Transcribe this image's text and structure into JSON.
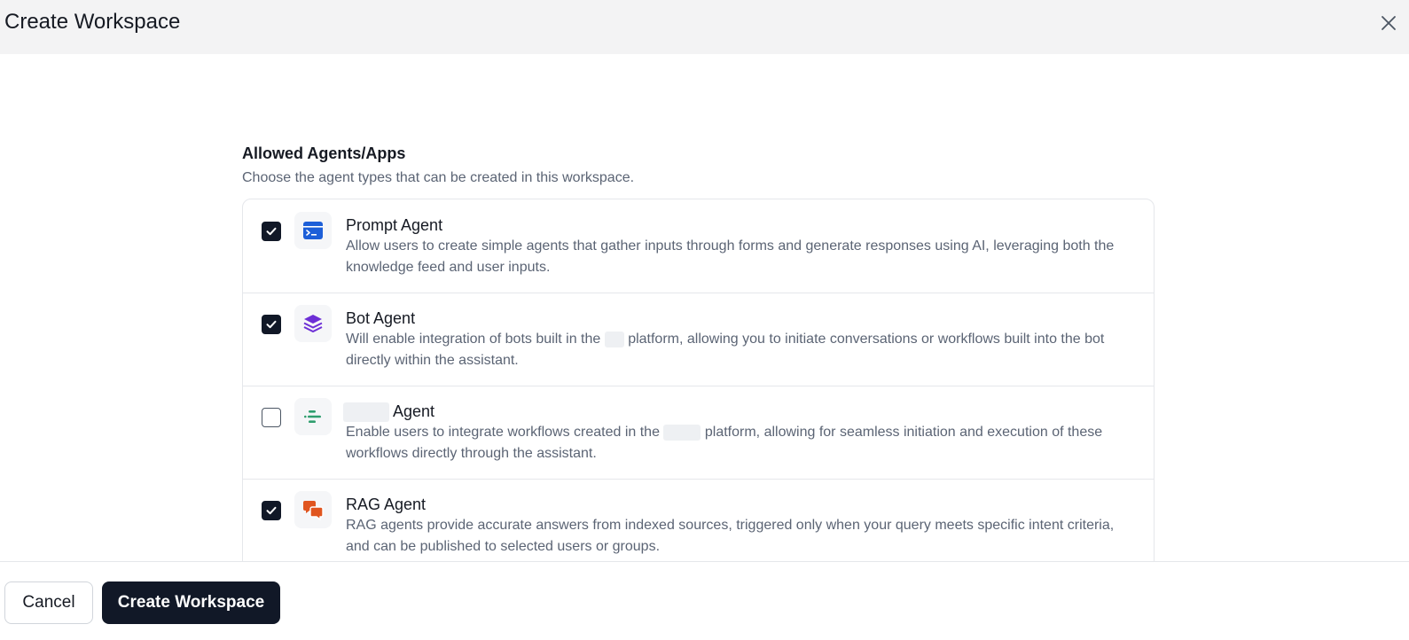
{
  "header": {
    "title": "Create Workspace",
    "close_icon": "close-icon"
  },
  "section": {
    "title": "Allowed Agents/Apps",
    "subtitle": "Choose the agent types that can be created in this workspace."
  },
  "agents": [
    {
      "name": "Prompt Agent",
      "checked": true,
      "icon": "prompt-agent-icon",
      "icon_color": "#1d5fd8",
      "description": "Allow users to create simple agents that gather inputs through forms and generate responses using AI, leveraging both the knowledge feed and user inputs."
    },
    {
      "name": "Bot Agent",
      "checked": true,
      "icon": "bot-agent-icon",
      "icon_color": "#6d2fd6",
      "desc_before": "Will enable integration of bots built in the",
      "desc_after": "platform, allowing you to initiate conversations or workflows built into the bot directly within the assistant."
    },
    {
      "name": "Agent",
      "checked": false,
      "icon": "workflow-agent-icon",
      "icon_color": "#2f9e6e",
      "desc_before": "Enable users to integrate workflows created in the",
      "desc_after": "platform, allowing for seamless initiation and execution of these workflows directly through the assistant."
    },
    {
      "name": "RAG Agent",
      "checked": true,
      "icon": "rag-agent-icon",
      "icon_color": "#e0551f",
      "description": "RAG agents provide accurate answers from indexed sources, triggered only when your query meets specific intent criteria, and can be published to selected users or groups."
    }
  ],
  "footer": {
    "cancel_label": "Cancel",
    "create_label": "Create Workspace"
  }
}
